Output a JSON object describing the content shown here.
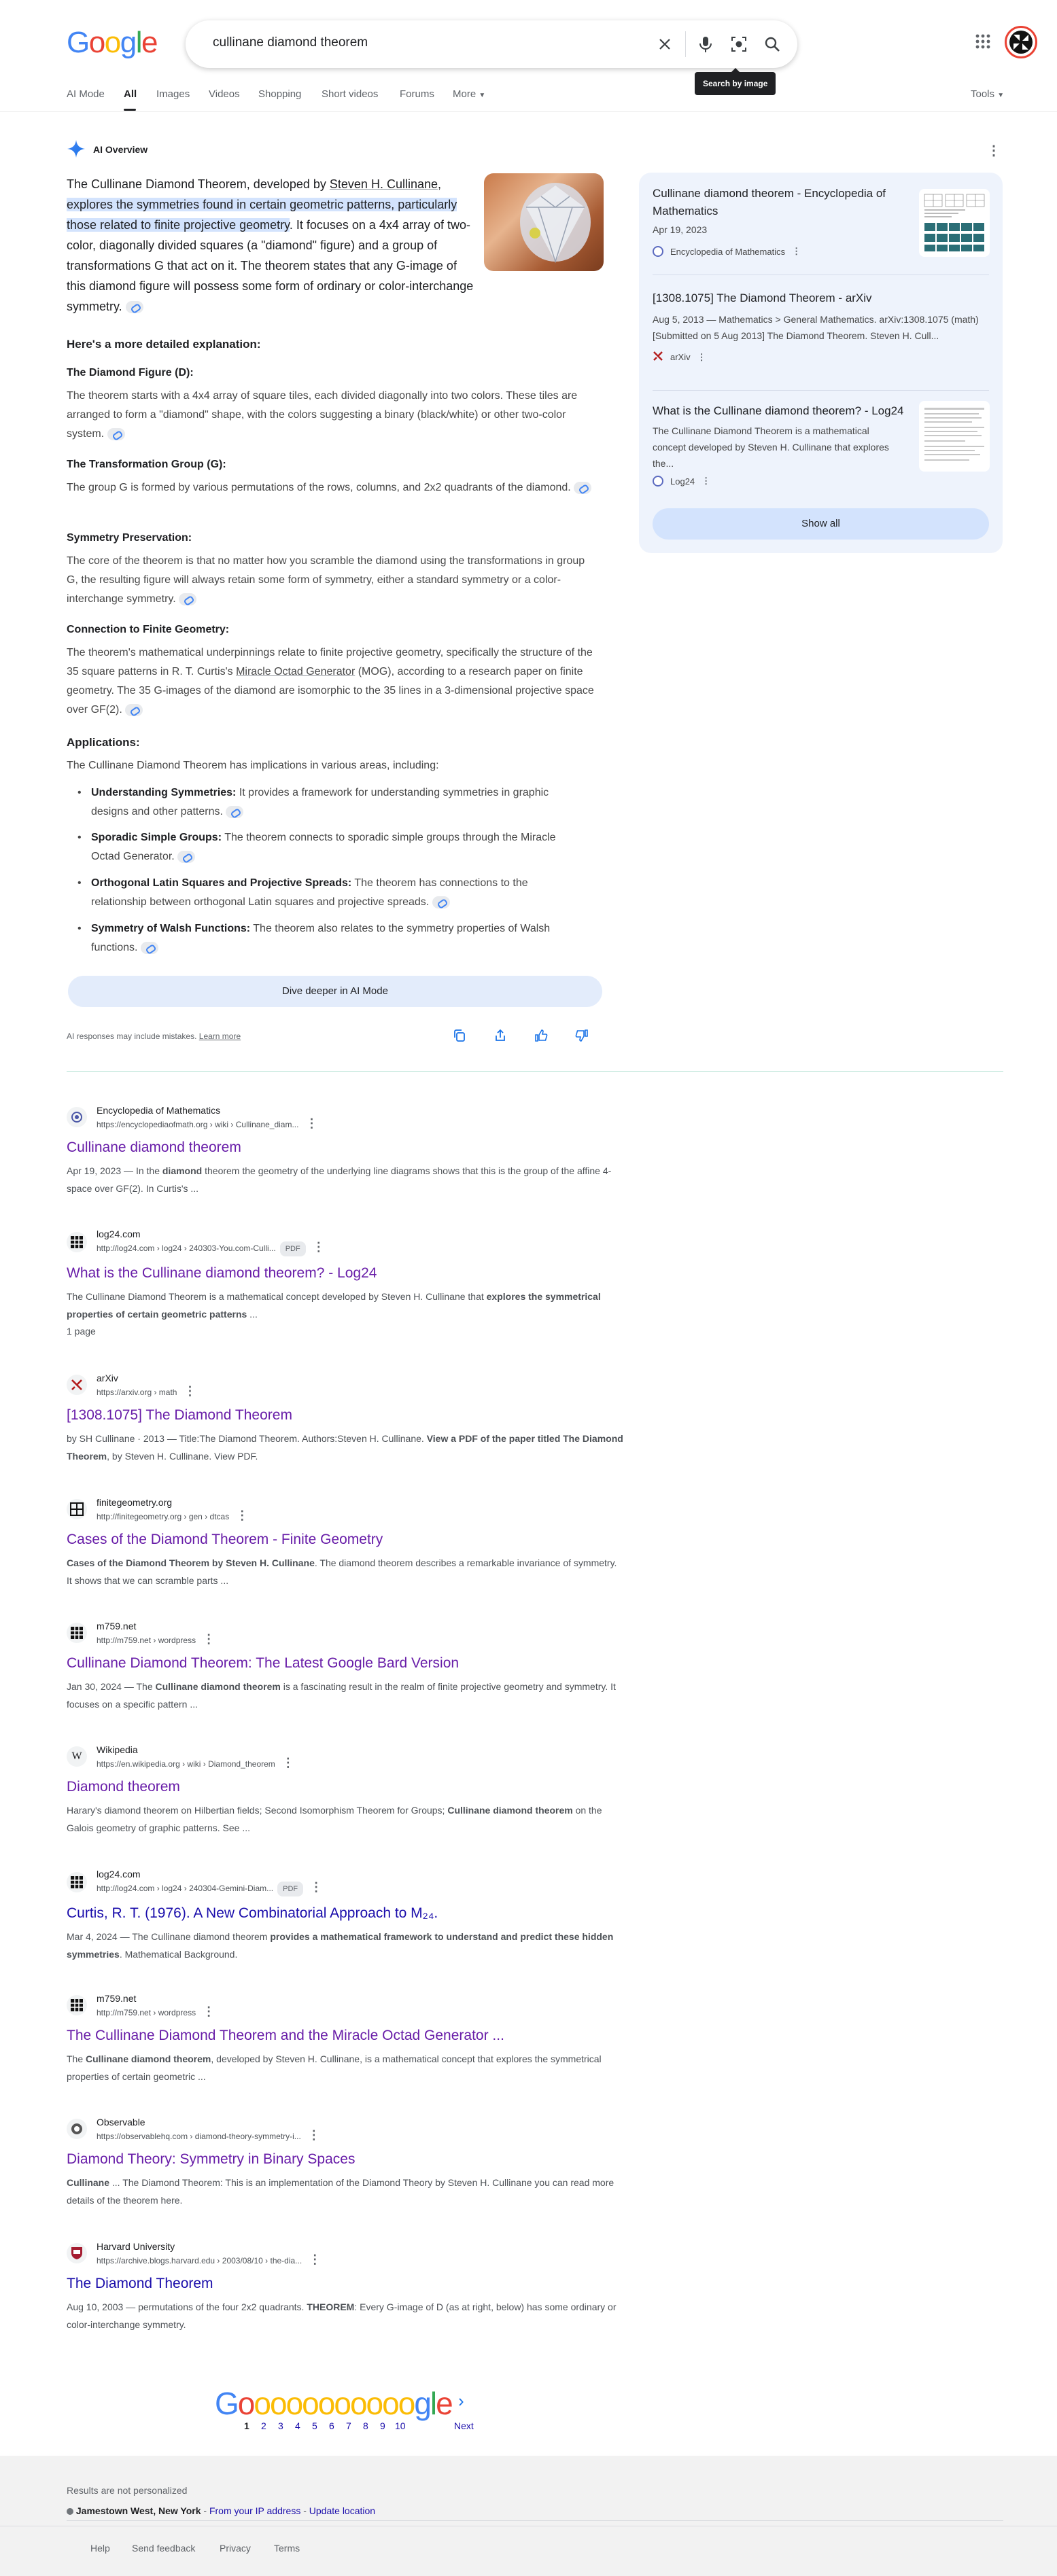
{
  "header": {
    "logo": "Google",
    "search_query": "cullinane diamond theorem",
    "tooltip": "Search by image",
    "tabs": [
      "AI Mode",
      "All",
      "Images",
      "Videos",
      "Shopping",
      "Short videos",
      "Forums",
      "More"
    ],
    "active_tab": "All",
    "tools": "Tools"
  },
  "ai_overview": {
    "title": "AI Overview",
    "lead_plain_1": "The Cullinane Diamond Theorem, developed by ",
    "lead_link": "Steven H. Cullinane",
    "lead_plain_2": ", ",
    "lead_highlight": "explores the symmetries found in certain geometric patterns, particularly those related to finite projective geometry",
    "lead_plain_3": ". It focuses on a 4x4 array of two-color, diagonally divided squares (a \"diamond\" figure) and a group of transformations G that act on it. The theorem states that any G-image of this diamond figure will possess some form of ordinary or color-interchange symmetry.",
    "explanation_heading": "Here's a more detailed explanation:",
    "sections": [
      {
        "heading": "The Diamond Figure (D):",
        "text": "The theorem starts with a 4x4 array of square tiles, each divided diagonally into two colors. These tiles are arranged to form a \"diamond\" shape, with the colors suggesting a binary (black/white) or other two-color system."
      },
      {
        "heading": "The Transformation Group (G):",
        "text": "The group G is formed by various permutations of the rows, columns, and 2x2 quadrants of the diamond."
      },
      {
        "heading": "Symmetry Preservation:",
        "text": "The core of the theorem is that no matter how you scramble the diamond using the transformations in group G, the resulting figure will always retain some form of symmetry, either a standard symmetry or a color-interchange symmetry."
      },
      {
        "heading": "Connection to Finite Geometry:",
        "text_1": "The theorem's mathematical underpinnings relate to finite projective geometry, specifically the structure of the 35 square patterns in R. T. Curtis's ",
        "text_link": "Miracle Octad Generator",
        "text_2": " (MOG), according to a research paper on finite geometry. The 35 G-images of the diamond are isomorphic to the 35 lines in a 3-dimensional projective space over GF(2)."
      }
    ],
    "applications_heading": "Applications:",
    "applications_intro": "The Cullinane Diamond Theorem has implications in various areas, including:",
    "applications": [
      {
        "term": "Understanding Symmetries:",
        "text": " It provides a framework for understanding symmetries in graphic designs and other patterns."
      },
      {
        "term": "Sporadic Simple Groups:",
        "text": " The theorem connects to sporadic simple groups through the Miracle Octad Generator."
      },
      {
        "term": "Orthogonal Latin Squares and Projective Spreads:",
        "text": " The theorem has connections to the relationship between orthogonal Latin squares and projective spreads."
      },
      {
        "term": "Symmetry of Walsh Functions:",
        "text": " The theorem also relates to the symmetry properties of Walsh functions."
      }
    ],
    "dive_deeper": "Dive deeper in AI Mode",
    "disclaimer": "AI responses may include mistakes.",
    "learn_more": "Learn more",
    "sources": [
      {
        "title": "Cullinane diamond theorem - Encyclopedia of Mathematics",
        "date": "Apr 19, 2023",
        "site": "Encyclopedia of Mathematics"
      },
      {
        "title": "[1308.1075] The Diamond Theorem - arXiv",
        "snippet": "Aug 5, 2013 — Mathematics > General Mathematics. arXiv:1308.1075 (math) [Submitted on 5 Aug 2013] The Diamond Theorem. Steven H. Cull...",
        "site": "arXiv"
      },
      {
        "title": "What is the Cullinane diamond theorem? - Log24",
        "snippet": "The Cullinane Diamond Theorem is a mathematical concept developed by Steven H. Cullinane that explores the...",
        "site": "Log24"
      }
    ],
    "show_all": "Show all"
  },
  "results": [
    {
      "site": "Encyclopedia of Mathematics",
      "url": "https://encyclopediaofmath.org › wiki › Cullinane_diam...",
      "title": "Cullinane diamond theorem",
      "snippet_1": "Apr 19, 2023 — In the ",
      "bold_1": "diamond",
      "snippet_2": " theorem the geometry of the underlying line diagrams shows that this is the group of the affine 4-space over GF(2). In Curtis's ..."
    },
    {
      "site": "log24.com",
      "url": "http://log24.com › log24 › 240303-You.com-Culli...",
      "pdf": "PDF",
      "title": "What is the Cullinane diamond theorem? - Log24",
      "snippet_1": "The Cullinane Diamond Theorem is a mathematical concept developed by Steven H. Cullinane that ",
      "bold_1": "explores the symmetrical properties of certain geometric patterns",
      "snippet_2": " ...",
      "extra": "1 page"
    },
    {
      "site": "arXiv",
      "url": "https://arxiv.org › math",
      "title": "[1308.1075] The Diamond Theorem",
      "snippet_1": "by SH Cullinane · 2013 — Title:The Diamond Theorem. Authors:Steven H. Cullinane. ",
      "bold_1": "View a PDF of the paper titled The Diamond Theorem",
      "snippet_2": ", by Steven H. Cullinane. View PDF."
    },
    {
      "site": "finitegeometry.org",
      "url": "http://finitegeometry.org › gen › dtcas",
      "title": "Cases of the Diamond Theorem - Finite Geometry",
      "snippet_1": "",
      "bold_1": "Cases of the Diamond Theorem by Steven H. Cullinane",
      "snippet_2": ". The diamond theorem describes a remarkable invariance of symmetry. It shows that we can scramble parts ..."
    },
    {
      "site": "m759.net",
      "url": "http://m759.net › wordpress",
      "title": "Cullinane Diamond Theorem: The Latest Google Bard Version",
      "snippet_1": "Jan 30, 2024 — The ",
      "bold_1": "Cullinane diamond theorem",
      "snippet_2": " is a fascinating result in the realm of finite projective geometry and symmetry. It focuses on a specific pattern ..."
    },
    {
      "site": "Wikipedia",
      "url": "https://en.wikipedia.org › wiki › Diamond_theorem",
      "title": "Diamond theorem",
      "snippet_1": "Harary's diamond theorem on Hilbertian fields; Second Isomorphism Theorem for Groups; ",
      "bold_1": "Cullinane diamond theorem",
      "snippet_2": " on the Galois geometry of graphic patterns. See ..."
    },
    {
      "site": "log24.com",
      "url": "http://log24.com › log24 › 240304-Gemini-Diam...",
      "pdf": "PDF",
      "title": "Curtis, R. T. (1976). A New Combinatorial Approach to M₂₄.",
      "snippet_1": "Mar 4, 2024 — The Cullinane diamond theorem ",
      "bold_1": "provides a mathematical framework to understand and predict these hidden symmetries",
      "snippet_2": ". Mathematical Background."
    },
    {
      "site": "m759.net",
      "url": "http://m759.net › wordpress",
      "title": "The Cullinane Diamond Theorem and the Miracle Octad Generator ...",
      "snippet_1": "The ",
      "bold_1": "Cullinane diamond theorem",
      "snippet_2": ", developed by Steven H. Cullinane, is a mathematical concept that explores the symmetrical properties of certain geometric ..."
    },
    {
      "site": "Observable",
      "url": "https://observablehq.com › diamond-theory-symmetry-i...",
      "title": "Diamond Theory: Symmetry in Binary Spaces",
      "snippet_1": "",
      "bold_1": "Cullinane",
      "snippet_2": " ... The Diamond Theorem: This is an implementation of the Diamond Theory by Steven H. Cullinane you can read more details of the theorem here."
    },
    {
      "site": "Harvard University",
      "url": "https://archive.blogs.harvard.edu › 2003/08/10 › the-dia...",
      "title": "The Diamond Theorem",
      "snippet_1": "Aug 10, 2003 — permutations of the four 2x2 quadrants. ",
      "bold_1": "THEOREM",
      "snippet_2": ": Every G-image of D (as at right, below) has some ordinary or color-interchange symmetry."
    }
  ],
  "pagination": {
    "pages": [
      "1",
      "2",
      "3",
      "4",
      "5",
      "6",
      "7",
      "8",
      "9",
      "10"
    ],
    "next": "Next"
  },
  "footer": {
    "personalized": "Results are not personalized",
    "location": "Jamestown West, New York",
    "from_ip": "From your IP address",
    "update_location": "Update location",
    "links": [
      "Help",
      "Send feedback",
      "Privacy",
      "Terms"
    ]
  }
}
